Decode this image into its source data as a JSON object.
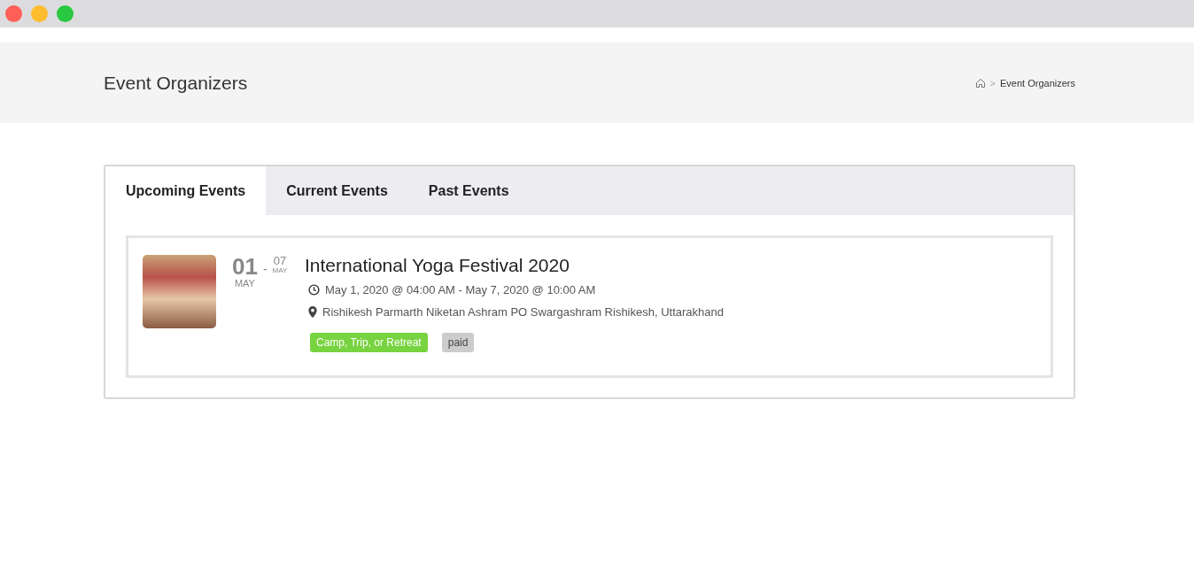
{
  "page_header": {
    "title": "Event Organizers",
    "breadcrumb": [
      {
        "label": "Event Organizers"
      }
    ],
    "breadcrumb_separator": ">"
  },
  "tabs": [
    {
      "label": "Upcoming Events",
      "selected": true
    },
    {
      "label": "Current Events",
      "selected": false
    },
    {
      "label": "Past Events",
      "selected": false
    }
  ],
  "events": [
    {
      "start_day": "01",
      "start_month": "MAY",
      "separator": "-",
      "end_day": "07",
      "end_month": "MAY",
      "title": "International Yoga Festival 2020",
      "time": "May 1, 2020 @ 04:00 AM - May 7, 2020 @ 10:00 AM",
      "location": "Rishikesh Parmarth Niketan Ashram PO Swargashram Rishikesh, Uttarakhand",
      "tags": [
        {
          "label": "Camp, Trip, or Retreat",
          "color": "#77d33f"
        },
        {
          "label": "paid",
          "color": "#cccccc"
        }
      ]
    }
  ]
}
